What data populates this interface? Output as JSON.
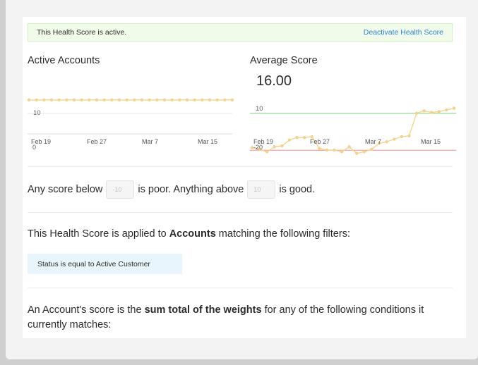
{
  "notice": {
    "message": "This Health Score is active.",
    "action": "Deactivate Health Score"
  },
  "charts": [
    {
      "title": "Active Accounts",
      "value": "",
      "ref_line_label": "10",
      "x_ticks": [
        "Feb 19",
        "Feb 27",
        "Mar 7",
        "Mar 15"
      ],
      "y_floor_label": "0"
    },
    {
      "title": "Average Score",
      "value": "16.00",
      "ref_line_label": "10",
      "x_ticks": [
        "Feb 19",
        "Feb 27",
        "Mar 7",
        "Mar 15"
      ],
      "y_floor_label": "-20"
    }
  ],
  "chart_data": [
    {
      "type": "line",
      "title": "Active Accounts",
      "x": [
        "Feb 19",
        "Feb 20",
        "Feb 21",
        "Feb 22",
        "Feb 23",
        "Feb 24",
        "Feb 25",
        "Feb 26",
        "Feb 27",
        "Feb 28",
        "Mar 1",
        "Mar 2",
        "Mar 3",
        "Mar 4",
        "Mar 5",
        "Mar 6",
        "Mar 7",
        "Mar 8",
        "Mar 9",
        "Mar 10",
        "Mar 11",
        "Mar 12",
        "Mar 13",
        "Mar 14",
        "Mar 15",
        "Mar 16",
        "Mar 17",
        "Mar 18"
      ],
      "values": [
        16,
        16,
        16,
        16,
        16,
        16,
        16,
        16,
        16,
        16,
        16,
        16,
        16,
        16,
        16,
        16,
        16,
        16,
        16,
        16,
        16,
        16,
        16,
        16,
        16,
        16,
        16,
        16
      ],
      "threshold": 10,
      "ylim": [
        0,
        20
      ],
      "color": "#f5d28a"
    },
    {
      "type": "line",
      "title": "Average Score",
      "x": [
        "Feb 19",
        "Feb 20",
        "Feb 21",
        "Feb 22",
        "Feb 23",
        "Feb 24",
        "Feb 25",
        "Feb 26",
        "Feb 27",
        "Feb 28",
        "Mar 1",
        "Mar 2",
        "Mar 3",
        "Mar 4",
        "Mar 5",
        "Mar 6",
        "Mar 7",
        "Mar 8",
        "Mar 9",
        "Mar 10",
        "Mar 11",
        "Mar 12",
        "Mar 13",
        "Mar 14",
        "Mar 15",
        "Mar 16",
        "Mar 17",
        "Mar 18"
      ],
      "values": [
        -10.5,
        -11.5,
        -13,
        -10,
        -9.5,
        -6,
        -4.5,
        -4.5,
        -4,
        -11,
        -12,
        -12,
        -13,
        -10,
        -14,
        -13,
        -11.5,
        -8,
        -7,
        -5.5,
        -4,
        -3.5,
        10,
        11.5,
        10.5,
        11,
        12,
        13
      ],
      "good_threshold": 10,
      "poor_threshold": -10,
      "ylim": [
        -20,
        20
      ],
      "color": "#f5d28a",
      "good_color": "#7ed07e",
      "poor_color": "#f08f8f"
    }
  ],
  "thresholds": {
    "prefix": "Any score below",
    "poor_value": "-10",
    "middle": "is poor. Anything above",
    "good_value": "10",
    "suffix": "is good."
  },
  "filters": {
    "intro_pre": "This Health Score is applied to",
    "intro_bold": "Accounts",
    "intro_post": "matching the following filters:",
    "items": [
      "Status is equal to Active Customer"
    ]
  },
  "conditions": {
    "pre": "An Account's score is the",
    "bold": "sum total of the weights",
    "post": "for any of the following conditions it currently matches:"
  },
  "colors": {
    "accent_link": "#2f7fd6",
    "notice_bg": "#f0fbe9",
    "filter_bg": "#e9f5fc"
  }
}
